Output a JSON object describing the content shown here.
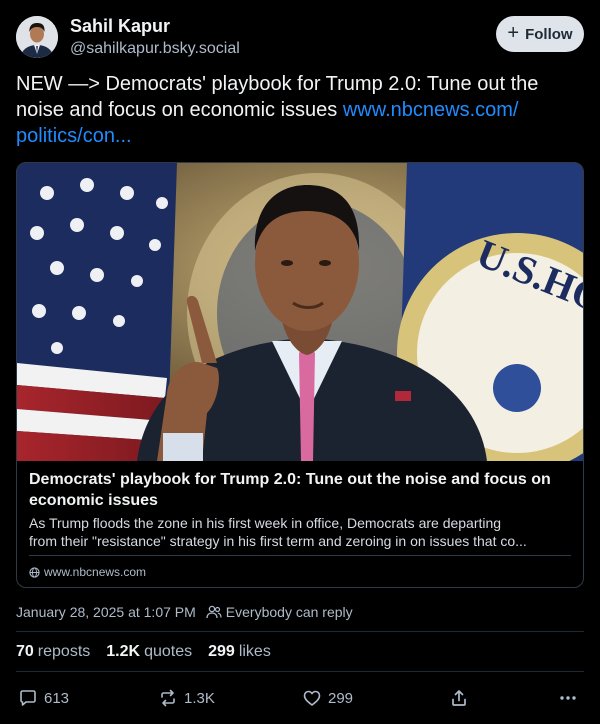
{
  "author": {
    "name": "Sahil Kapur",
    "handle": "@sahilkapur.bsky.social",
    "follow_label": "Follow"
  },
  "post": {
    "text": "NEW —> Democrats' playbook for Trump 2.0: Tune out the noise and focus on economic issues ",
    "link_text": "www.nbcnews.com/ politics/con..."
  },
  "card": {
    "title": "Democrats' playbook for Trump 2.0: Tune out the noise and focus on economic issues",
    "description_line1": "As Trump floods the zone in his first week in office, Democrats are departing",
    "description_line2": "from their \"resistance\" strategy in his first term and zeroing in on issues that co...",
    "domain": "www.nbcnews.com"
  },
  "meta": {
    "timestamp": "January 28, 2025 at 1:07 PM",
    "reply_setting": "Everybody can reply"
  },
  "stats": {
    "reposts_count": "70",
    "reposts_label": "reposts",
    "quotes_count": "1.2K",
    "quotes_label": "quotes",
    "likes_count": "299",
    "likes_label": "likes"
  },
  "actions": {
    "reply_count": "613",
    "repost_count": "1.3K",
    "like_count": "299"
  },
  "colors": {
    "background": "#000000",
    "link": "#208bfe",
    "muted": "#aebbc9",
    "follow_bg": "#dfe4ea"
  }
}
